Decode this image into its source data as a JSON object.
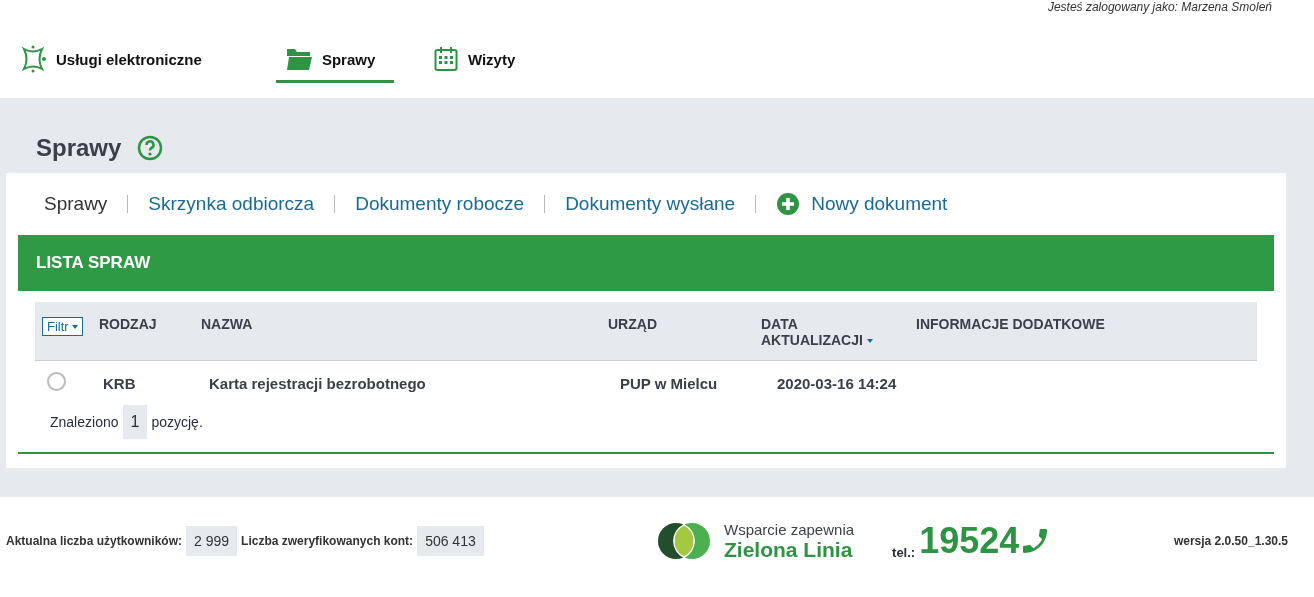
{
  "user_bar": {
    "text": "Jesteś zalogowany jako: Marzena Smoleń"
  },
  "nav": [
    {
      "label": "Usługi elektroniczne",
      "selected": false
    },
    {
      "label": "Sprawy",
      "selected": true
    },
    {
      "label": "Wizyty",
      "selected": false
    }
  ],
  "page_title": "Sprawy",
  "subtabs": [
    {
      "label": "Sprawy",
      "selected": true,
      "kind": "tab"
    },
    {
      "label": "Skrzynka odbiorcza",
      "selected": false,
      "kind": "tab"
    },
    {
      "label": "Dokumenty robocze",
      "selected": false,
      "kind": "tab"
    },
    {
      "label": "Dokumenty wysłane",
      "selected": false,
      "kind": "tab"
    },
    {
      "label": "Nowy dokument",
      "kind": "action"
    }
  ],
  "panel_title": "LISTA SPRAW",
  "table": {
    "filter": "Filtr",
    "columns": [
      {
        "label": "RODZAJ",
        "sorted": false
      },
      {
        "label": "NAZWA",
        "sorted": false
      },
      {
        "label": "URZĄD",
        "sorted": false
      },
      {
        "label": "DATA AKTUALIZACJI",
        "sorted": true
      },
      {
        "label": "INFORMACJE DODATKOWE",
        "sorted": false
      }
    ],
    "rows": [
      {
        "selected": false,
        "cells": [
          "KRB",
          "Karta rejestracji bezrobotnego",
          "PUP w Mielcu",
          "2020-03-16 14:24",
          ""
        ]
      }
    ]
  },
  "found": {
    "before": "Znaleziono",
    "count": "1",
    "after": "pozycję."
  },
  "footer": {
    "users_label": "Aktualna liczba użytkowników:",
    "users": "2 999",
    "accounts_label": "Liczba zweryfikowanych kont:",
    "accounts": "506 413",
    "support_line": "Wsparcie zapewnia",
    "support_name": "Zielona Linia",
    "tel_label": "tel.:",
    "tel": "19524",
    "version": "wersja 2.0.50_1.30.5"
  }
}
